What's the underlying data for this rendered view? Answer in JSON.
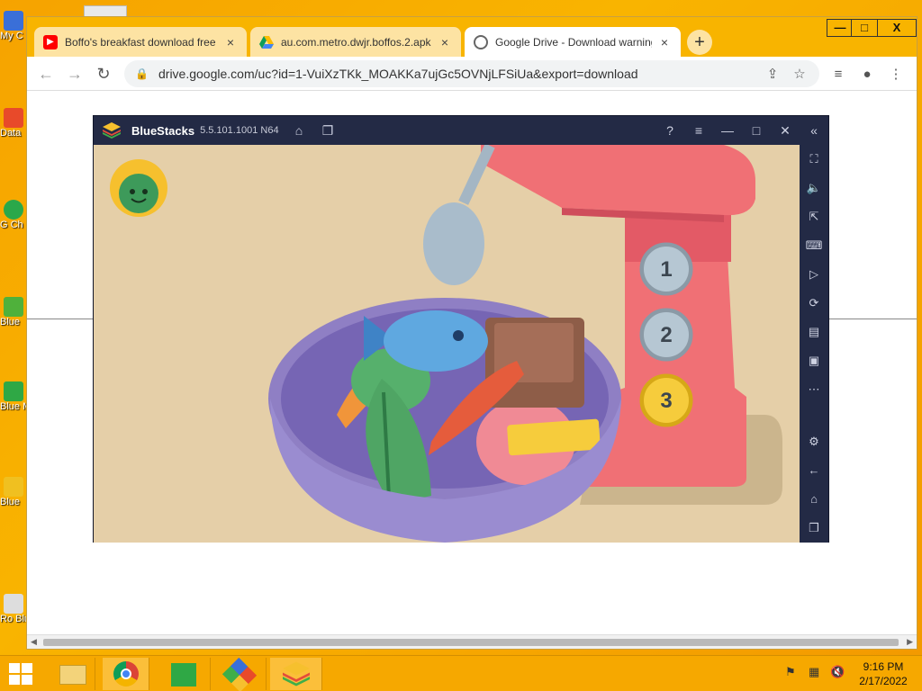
{
  "browser": {
    "tabs": [
      {
        "title": "Boffo's breakfast download free |",
        "icon": "youtube-icon"
      },
      {
        "title": "au.com.metro.dwjr.boffos.2.apk -",
        "icon": "google-drive-icon"
      },
      {
        "title": "Google Drive - Download warning",
        "icon": "globe-icon"
      }
    ],
    "url": "drive.google.com/uc?id=1-VuiXzTKk_MOAKKa7ujGc5OVNjLFSiUa&export=download",
    "window_controls": {
      "minimize": "—",
      "maximize": "□",
      "close": "X"
    }
  },
  "bluestacks": {
    "name": "BlueStacks",
    "version": "5.5.101.1001 N64"
  },
  "game": {
    "buttons": [
      "1",
      "2",
      "3"
    ],
    "selected_button": "3",
    "colors": {
      "background": "#e5cfa8",
      "mixer": "#f07075",
      "bowl": "#8f7fc4",
      "selected": "#f6cc3c",
      "button": "#b6c7d3"
    }
  },
  "taskbar": {
    "time": "9:16 PM",
    "date": "2/17/2022"
  },
  "desktop": {
    "icons": [
      "My C",
      "Data",
      "G\nCh",
      "Blue",
      "Blue\nMulti",
      "Blue",
      "Ro\nBlue"
    ]
  }
}
